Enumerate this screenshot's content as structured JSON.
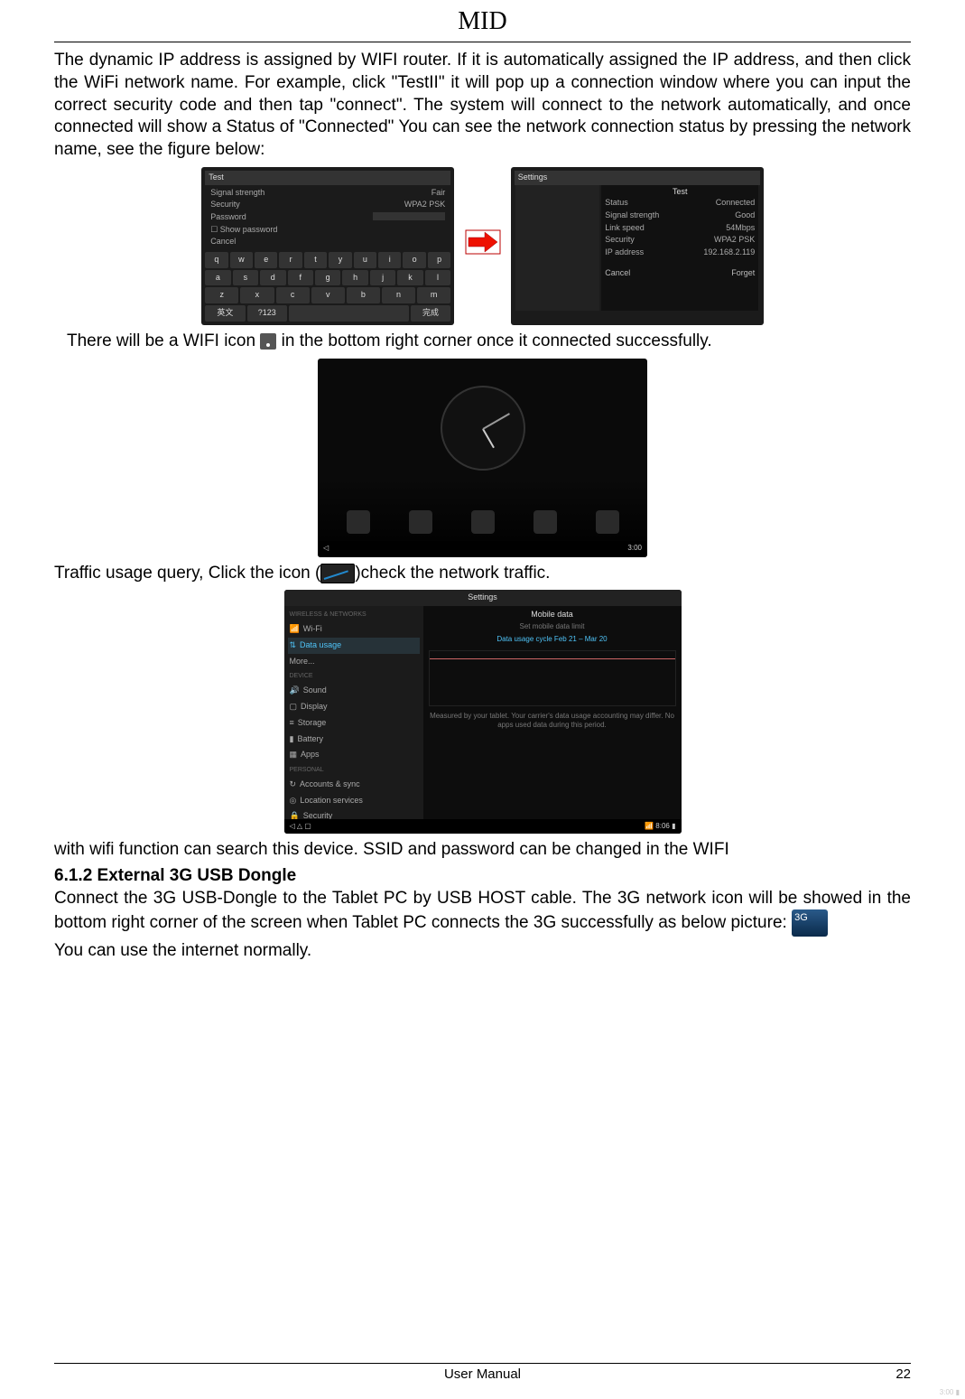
{
  "header": {
    "title": "MID"
  },
  "para1": "The dynamic IP address is assigned by WIFI router. If it is automatically assigned the IP address, and then click the WiFi network name. For example, click \"TestII\" it will pop up a connection window where you can input the correct security code and then tap \"connect\". The system will connect to the network automatically, and once connected will show a Status of \"Connected\" You can see the network connection status by pressing the network name, see the figure below:",
  "fig1": {
    "left": {
      "title": "Test",
      "rows": [
        {
          "k": "Signal strength",
          "v": "Fair"
        },
        {
          "k": "Security",
          "v": "WPA2 PSK"
        }
      ],
      "password_label": "Password",
      "show_label": "Show password",
      "cancel": "Cancel",
      "keyboard": [
        [
          "q",
          "w",
          "e",
          "r",
          "t",
          "y",
          "u",
          "i",
          "o",
          "p"
        ],
        [
          "a",
          "s",
          "d",
          "f",
          "g",
          "h",
          "j",
          "k",
          "l"
        ],
        [
          "z",
          "x",
          "c",
          "v",
          "b",
          "n",
          "m"
        ],
        [
          "英文",
          "?123",
          "",
          "",
          "完成"
        ]
      ]
    },
    "right": {
      "title": "Test",
      "rows": [
        {
          "k": "Status",
          "v": "Connected"
        },
        {
          "k": "Signal strength",
          "v": "Good"
        },
        {
          "k": "Link speed",
          "v": "54Mbps"
        },
        {
          "k": "Security",
          "v": "WPA2 PSK"
        },
        {
          "k": "IP address",
          "v": "192.168.2.119"
        }
      ],
      "cancel": "Cancel",
      "forget": "Forget"
    }
  },
  "para2a": "There will be a WIFI icon ",
  "para2b": " in the bottom right corner once it connected successfully.",
  "fig_home": {
    "time": "3:00"
  },
  "para3a": "Traffic usage query, Click the icon (",
  "para3b": ")check the network traffic.",
  "fig_settings": {
    "title": "Settings",
    "left_items": [
      "Wi-Fi",
      "Data usage",
      "More...",
      "Sound",
      "Display",
      "Storage",
      "Battery",
      "Apps",
      "Accounts & sync",
      "Location services",
      "Security"
    ],
    "left_section1": "WIRELESS & NETWORKS",
    "left_section2": "DEVICE",
    "left_section3": "PERSONAL",
    "right_header": "Mobile data",
    "right_sub": "Set mobile data limit",
    "cycle": "Data usage cycle   Feb 21 – Mar 20",
    "note": "Measured by your tablet. Your carrier's data usage accounting may differ. No apps used data during this period.",
    "status_time": "8:06"
  },
  "para4": "with wifi function can search this device. SSID and password can be changed in the WIFI",
  "heading612": "6.1.2 External 3G USB Dongle",
  "para5": "Connect the 3G USB-Dongle to the Tablet PC by USB HOST cable. The 3G network icon will be showed in the bottom right corner of the screen when Tablet PC connects the 3G successfully as below picture: ",
  "para6": "You can use the internet normally.",
  "footer": {
    "center": "User Manual",
    "page": "22"
  }
}
